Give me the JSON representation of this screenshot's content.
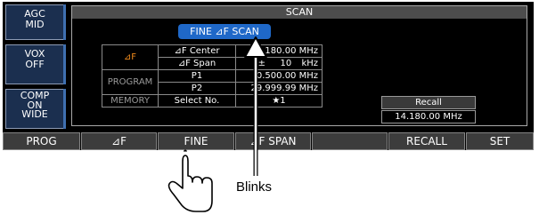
{
  "side": {
    "agc": [
      "AGC",
      "MID"
    ],
    "vox": [
      "VOX",
      "OFF"
    ],
    "comp": [
      "COMP",
      "ON",
      "WIDE"
    ]
  },
  "panel": {
    "title": "SCAN",
    "mode_badge": "FINE ⊿F SCAN"
  },
  "grid": {
    "df_header": "⊿F",
    "program_header": "PROGRAM",
    "memory_header": "MEMORY",
    "rows": {
      "df_center": {
        "label": "⊿F Center",
        "value": "14.180.00 MHz"
      },
      "df_span": {
        "label": "⊿F Span",
        "sign": "±",
        "num": "10",
        "unit": "kHz"
      },
      "p1": {
        "label": "P1",
        "value": "0.500.00 MHz"
      },
      "p2": {
        "label": "P2",
        "value": "29.999.99 MHz"
      },
      "memory": {
        "label": "Select No.",
        "value": "★1"
      }
    }
  },
  "recall": {
    "header": "Recall",
    "value": "14.180.00 MHz"
  },
  "softkeys": [
    "PROG",
    "⊿F",
    "FINE",
    "⊿F SPAN",
    "",
    "RECALL",
    "SET"
  ],
  "annotation": {
    "label": "Blinks"
  }
}
